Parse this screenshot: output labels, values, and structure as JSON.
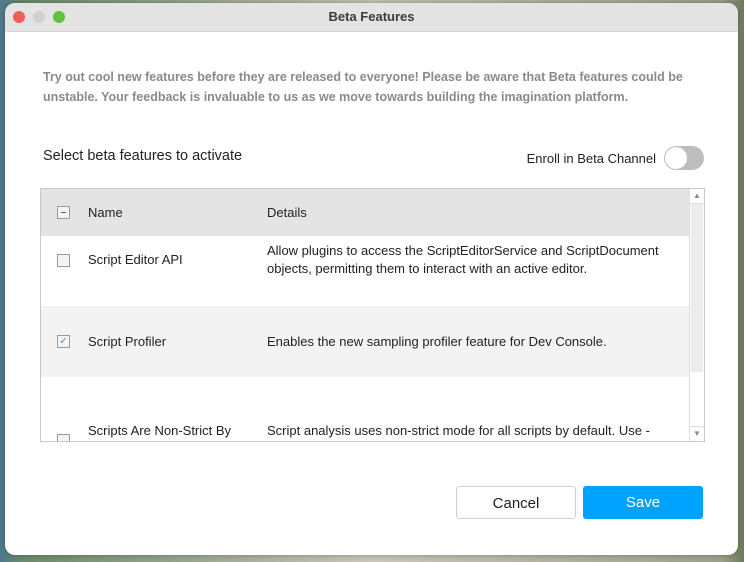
{
  "window": {
    "title": "Beta Features"
  },
  "intro": "Try out cool new features before they are released to everyone! Please be aware that Beta features could be unstable. Your feedback is invaluable to us as we move towards building the imagination platform.",
  "select_label": "Select beta features to activate",
  "enroll": {
    "label": "Enroll in Beta Channel",
    "enabled": false
  },
  "table": {
    "headers": {
      "name": "Name",
      "details": "Details"
    },
    "rows": [
      {
        "name": "Script Editor API",
        "details": "Allow plugins to access the ScriptEditorService and ScriptDocument objects, permitting them to interact with an active editor.",
        "checked": false
      },
      {
        "name": "Script Profiler",
        "details": "Enables the new sampling profiler feature for Dev Console.",
        "checked": true
      },
      {
        "name": "Scripts Are Non-Strict By Default",
        "details": "Script analysis uses non-strict mode for all scripts by default. Use --!strict, --!nonstrict or --!nocheck to override mode on a per script basis.",
        "checked": false
      }
    ]
  },
  "buttons": {
    "cancel": "Cancel",
    "save": "Save"
  },
  "colors": {
    "accent": "#00a2ff",
    "close": "#ee5f57",
    "zoom": "#5fc23f"
  }
}
